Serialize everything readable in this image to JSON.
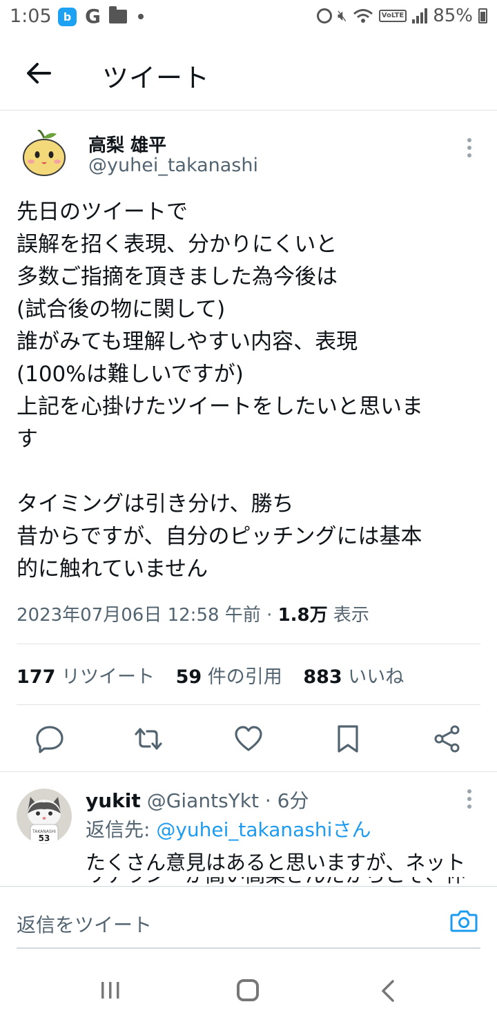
{
  "status_bar": {
    "time": "1:05",
    "app_letter": "b",
    "battery": "85%",
    "volte": "VoLTE"
  },
  "header": {
    "title": "ツイート"
  },
  "tweet": {
    "author_name": "高梨 雄平",
    "author_handle": "@yuhei_takanashi",
    "body_lines": [
      "先日のツイートで",
      "誤解を招く表現、分かりにくいと",
      "多数ご指摘を頂きました為今後は",
      "(試合後の物に関して)",
      "誰がみても理解しやすい内容、表現",
      "(100%は難しいですが)",
      "上記を心掛けたツイートをしたいと思いま",
      "す",
      "",
      "タイミングは引き分け、勝ち",
      "昔からですが、自分のピッチングには基本",
      "的に触れていません"
    ],
    "timestamp": "2023年07月06日 12:58 午前",
    "views_count": "1.8万",
    "views_label": "表示",
    "retweets_count": "177",
    "retweets_label": "リツイート",
    "quotes_count": "59",
    "quotes_label": "件の引用",
    "likes_count": "883",
    "likes_label": "いいね"
  },
  "actions": [
    "reply-icon",
    "retweet-icon",
    "like-icon",
    "bookmark-icon",
    "share-icon"
  ],
  "reply": {
    "name": "yukit",
    "handle_time": "@GiantsYkt · 6分",
    "reply_prefix": "返信先: ",
    "reply_to": "@yuhei_takanashiさん",
    "text": "たくさん意見はあると思いますが、ネット",
    "text_cut": "リテラシーが高い高梨さんだからこそ、仲",
    "jersey_number": "53"
  },
  "compose": {
    "placeholder": "返信をツイート"
  },
  "colors": {
    "accent": "#1d9bf0",
    "secondary_text": "#536471",
    "primary_text": "#0f1419"
  }
}
